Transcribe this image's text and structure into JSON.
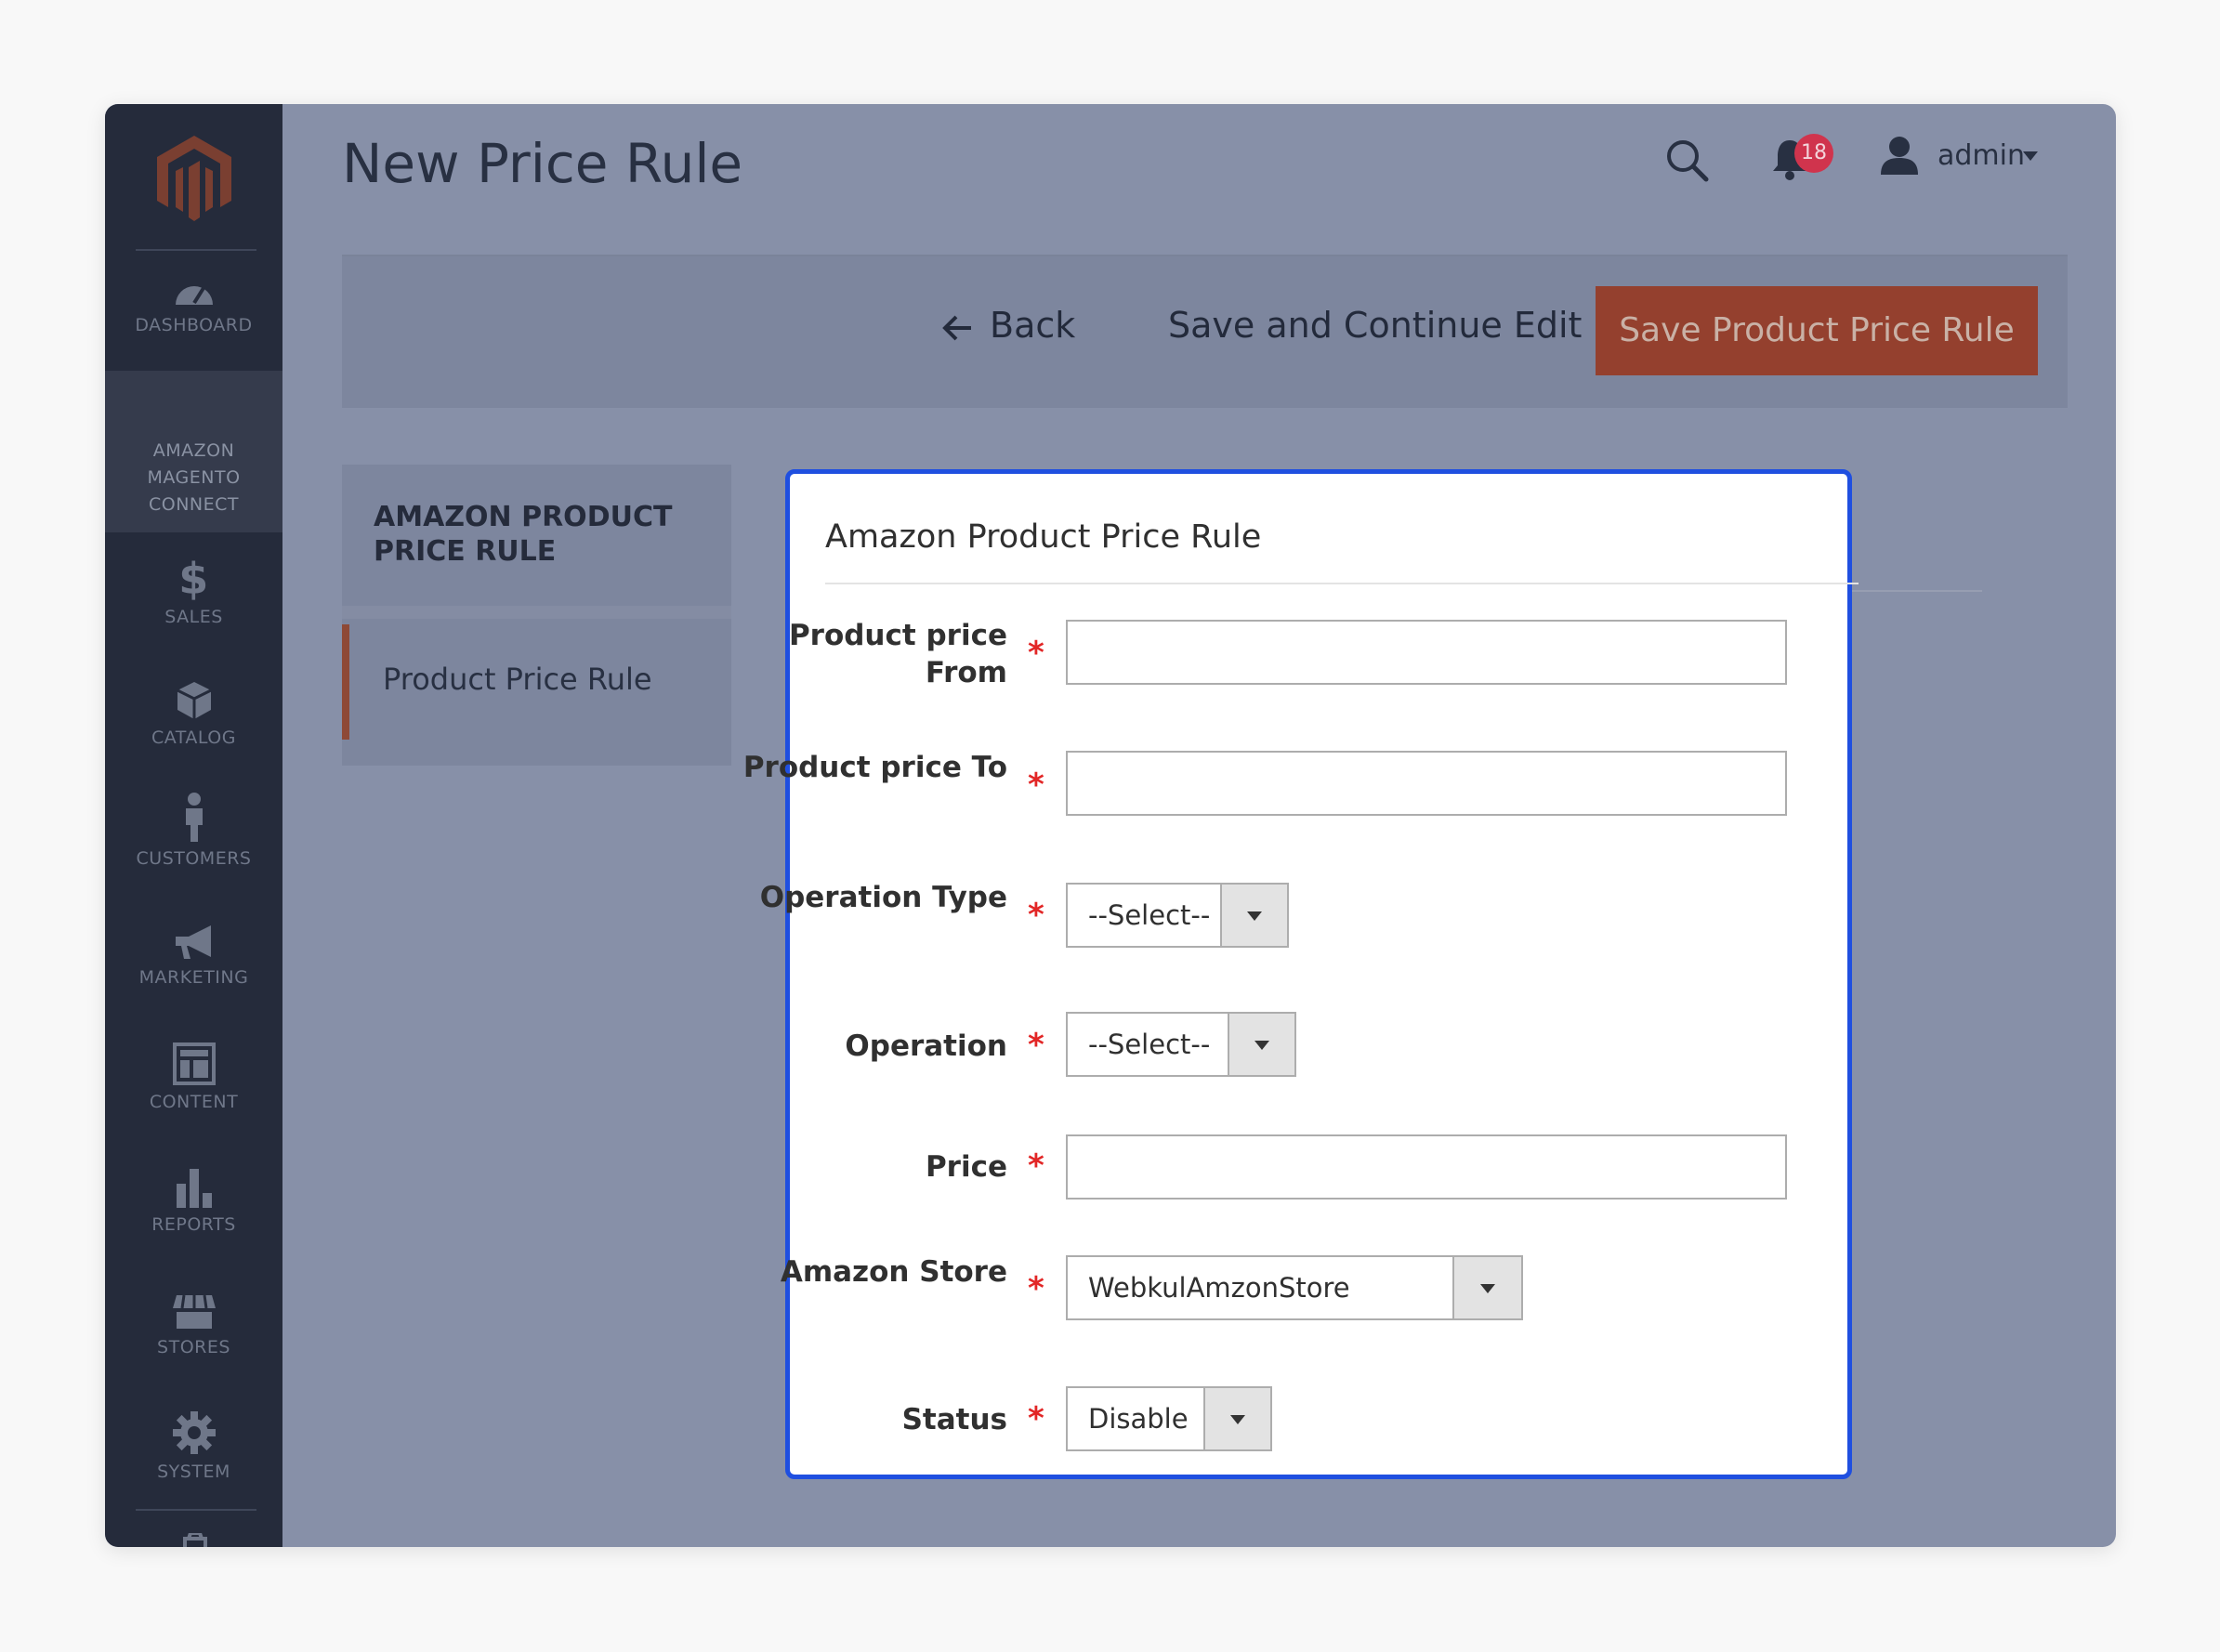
{
  "sidebar": {
    "items": [
      {
        "label": "DASHBOARD",
        "icon": "dashboard-icon"
      },
      {
        "label": "AMAZON MAGENTO CONNECT",
        "icon": "",
        "active": true
      },
      {
        "label": "SALES",
        "icon": "dollar-icon"
      },
      {
        "label": "CATALOG",
        "icon": "box-icon"
      },
      {
        "label": "CUSTOMERS",
        "icon": "person-icon"
      },
      {
        "label": "MARKETING",
        "icon": "megaphone-icon"
      },
      {
        "label": "CONTENT",
        "icon": "layout-icon"
      },
      {
        "label": "REPORTS",
        "icon": "bar-chart-icon"
      },
      {
        "label": "STORES",
        "icon": "store-icon"
      },
      {
        "label": "SYSTEM",
        "icon": "gear-icon"
      }
    ]
  },
  "header": {
    "title": "New Price Rule",
    "notification_count": "18",
    "user": "admin"
  },
  "actions": {
    "back": "Back",
    "save_continue": "Save and Continue Edit",
    "save": "Save Product Price Rule"
  },
  "left_panel": {
    "title": "AMAZON PRODUCT PRICE RULE",
    "item": "Product Price Rule"
  },
  "form": {
    "title": "Amazon Product Price Rule",
    "fields": [
      {
        "label": "Product price From",
        "type": "text",
        "value": ""
      },
      {
        "label": "Product price To",
        "type": "text",
        "value": ""
      },
      {
        "label": "Operation Type",
        "type": "select",
        "value": "--Select--"
      },
      {
        "label": "Operation",
        "type": "select",
        "value": "--Select--"
      },
      {
        "label": "Price",
        "type": "text",
        "value": ""
      },
      {
        "label": "Amazon Store",
        "type": "select",
        "value": "WebkulAmzonStore"
      },
      {
        "label": "Status",
        "type": "select",
        "value": "Disable"
      }
    ],
    "required_mark": "*"
  },
  "colors": {
    "sidebar": "#252b3b",
    "primary_button": "#94402e",
    "highlight_border": "#1f4fe0",
    "required": "#e22626"
  }
}
